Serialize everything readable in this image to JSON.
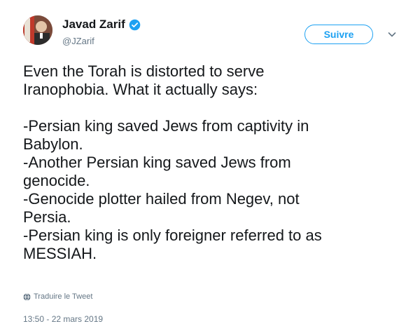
{
  "author": {
    "display_name": "Javad Zarif",
    "handle": "@JZarif",
    "verified": true
  },
  "follow_button": {
    "label": "Suivre"
  },
  "tweet": {
    "lines": [
      "Even the Torah is distorted to serve",
      "Iranophobia. What it actually says:",
      "",
      "-Persian king saved Jews from captivity in",
      "Babylon.",
      "-Another Persian king saved Jews from",
      "genocide.",
      "-Genocide plotter hailed from Negev, not",
      "Persia.",
      "-Persian king is only foreigner referred to as",
      "MESSIAH."
    ]
  },
  "translate_label": "Traduire le Tweet",
  "timestamp": "13:50 - 22 mars 2019",
  "colors": {
    "accent": "#1da1f2",
    "text": "#14171a",
    "secondary": "#657786"
  },
  "icons": {
    "verified": "verified-badge-icon",
    "menu": "chevron-down-icon",
    "translate": "globe-icon"
  }
}
